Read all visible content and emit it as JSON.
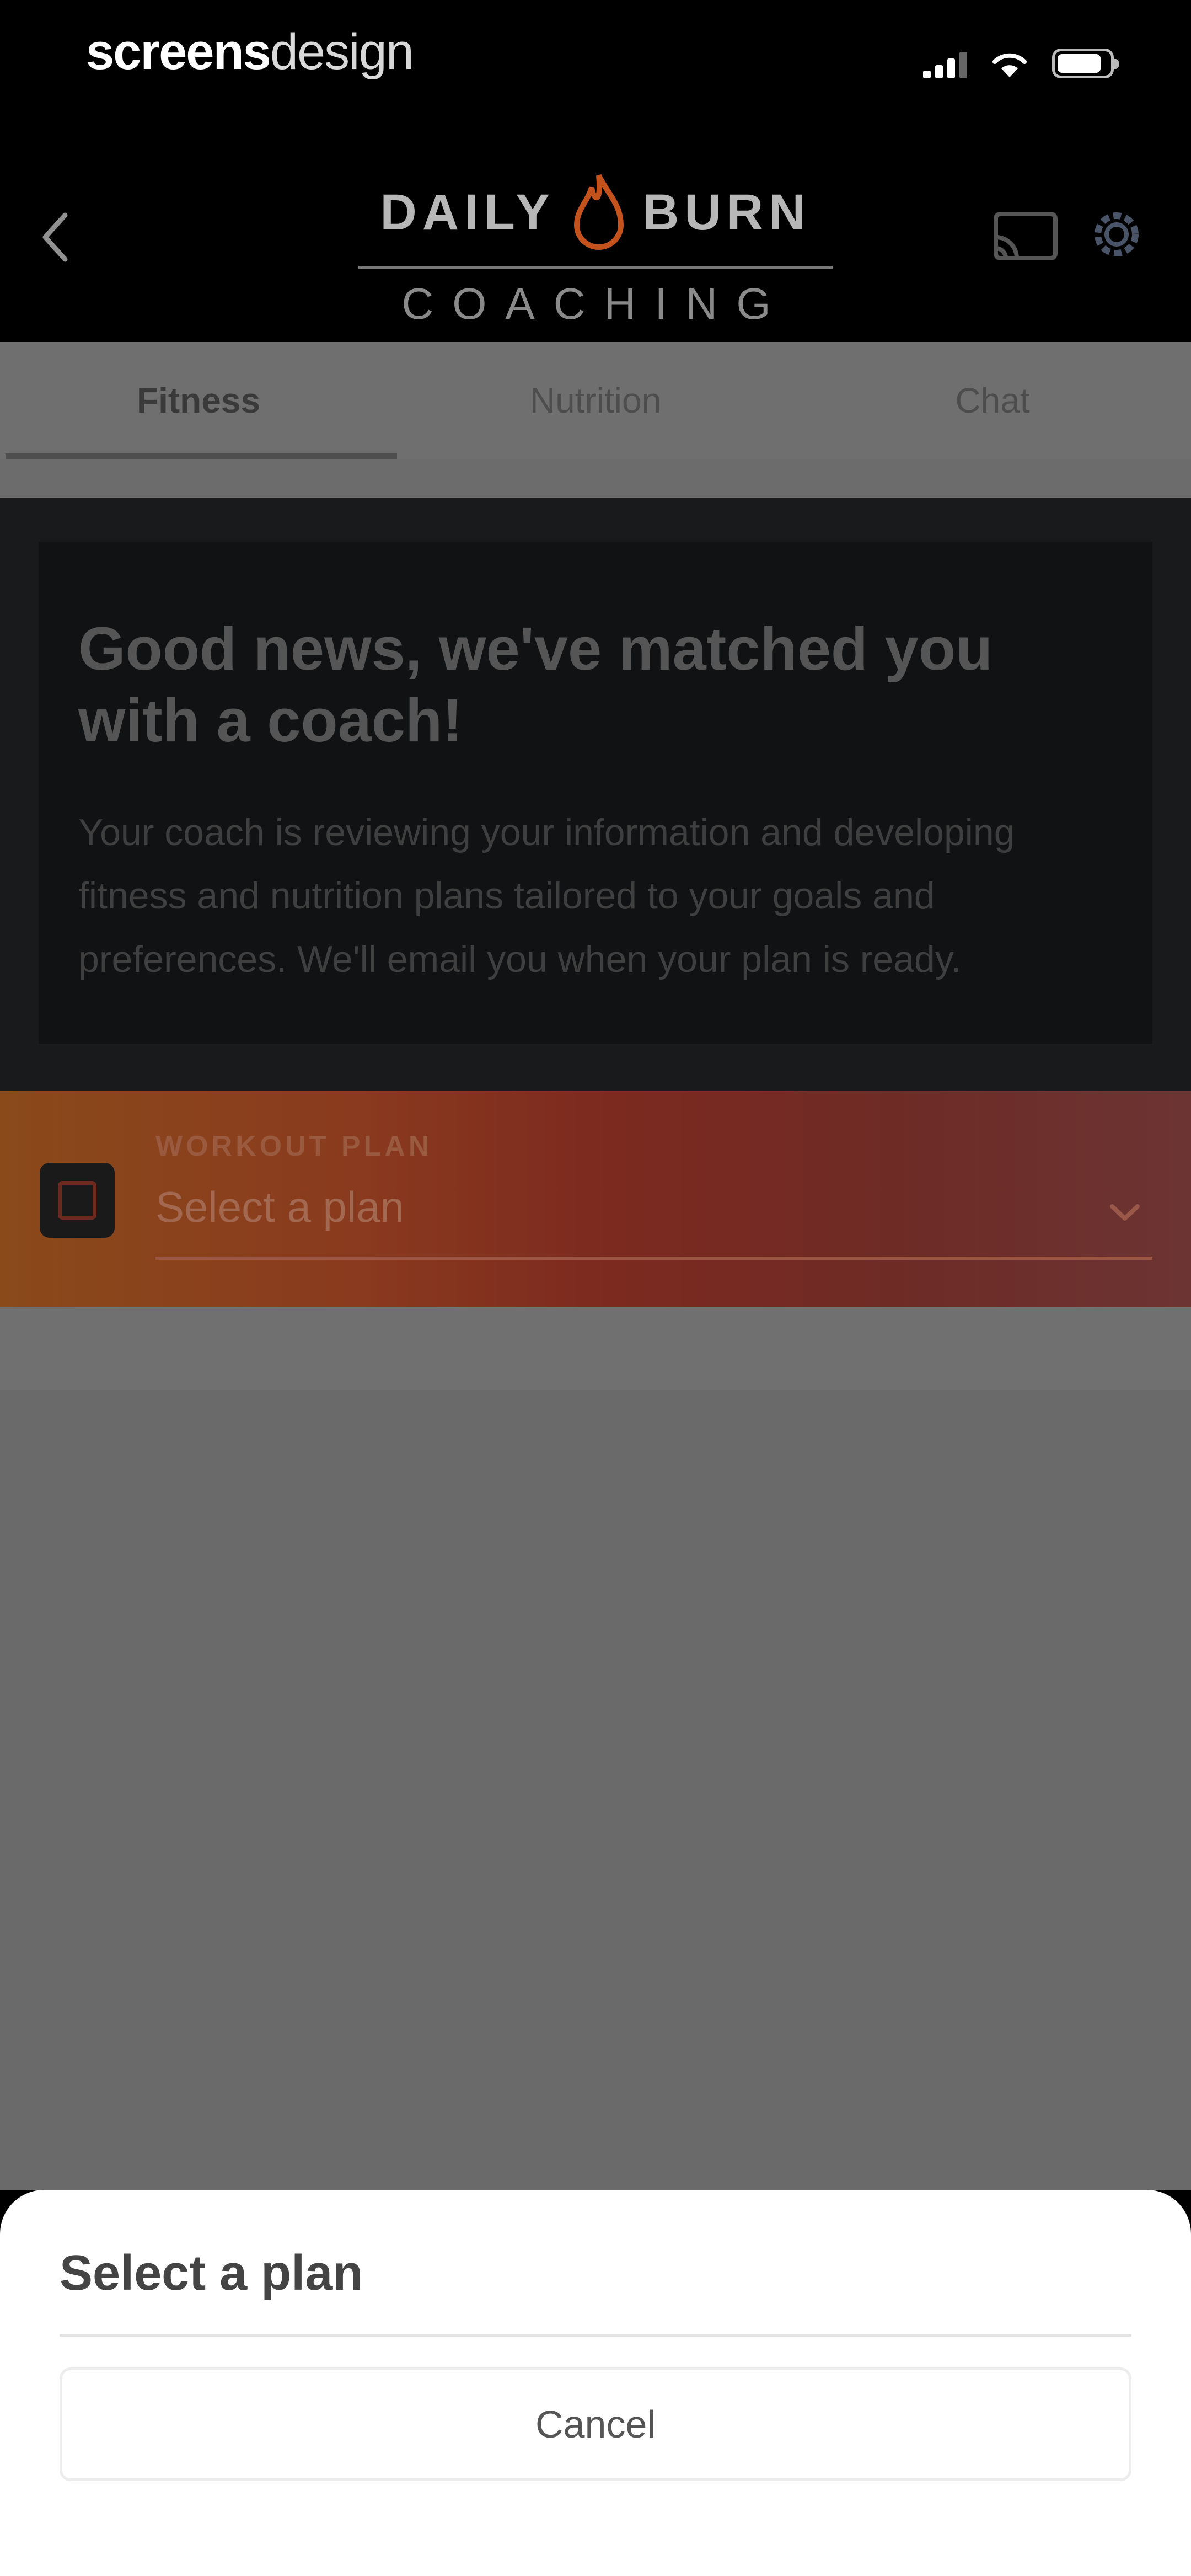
{
  "status_bar": {
    "brand_bold": "screens",
    "brand_light": "design"
  },
  "header": {
    "logo_left": "DAILY",
    "logo_right": "BURN",
    "logo_sub": "COACHING",
    "icons": [
      "back-chevron-icon",
      "cast-icon",
      "gear-icon"
    ]
  },
  "tabs": [
    {
      "label": "Fitness",
      "active": true
    },
    {
      "label": "Nutrition",
      "active": false
    },
    {
      "label": "Chat",
      "active": false
    }
  ],
  "card": {
    "title": "Good news, we've matched you with a coach!",
    "body": "Your coach is reviewing your information and developing fitness and nutrition plans tailored to your goals and preferences. We'll email you when your plan is ready."
  },
  "workout": {
    "label": "WORKOUT PLAN",
    "value": "Select a plan"
  },
  "sheet": {
    "title": "Select a plan",
    "cancel_label": "Cancel"
  },
  "colors": {
    "background": "#000000",
    "dimmed_overlay": "#6a6a6a",
    "workout_gradient_start": "#8a4a1a",
    "workout_gradient_end": "#6c3433",
    "sheet": "#ffffff"
  }
}
